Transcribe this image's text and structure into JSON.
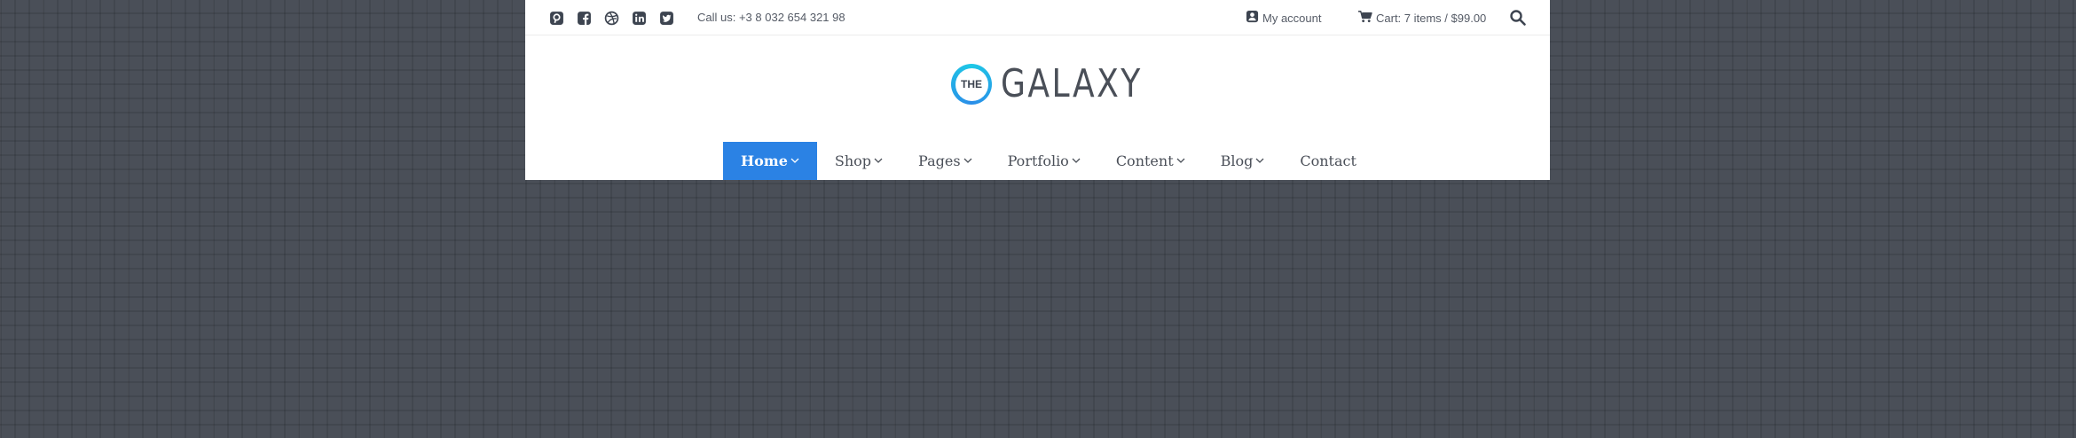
{
  "topbar": {
    "social_icons": [
      "pinterest-icon",
      "facebook-icon",
      "dribbble-icon",
      "linkedin-icon",
      "twitter-icon"
    ],
    "call_text": "Call us: +3 8 032 654 321 98",
    "account_label": "My account",
    "cart_label": "Cart: 7 items / $99.00"
  },
  "logo": {
    "badge_text": "THE",
    "wordmark": "GALAXY"
  },
  "nav": {
    "items": [
      {
        "label": "Home"
      },
      {
        "label": "Shop"
      },
      {
        "label": "Pages"
      },
      {
        "label": "Portfolio"
      },
      {
        "label": "Content"
      },
      {
        "label": "Blog"
      },
      {
        "label": "Contact"
      }
    ]
  },
  "colors": {
    "accent": "#2b82e4",
    "logo_ring_start": "#1ec8e6",
    "text_dark": "#4a4f58",
    "background": "#4a4f58"
  }
}
